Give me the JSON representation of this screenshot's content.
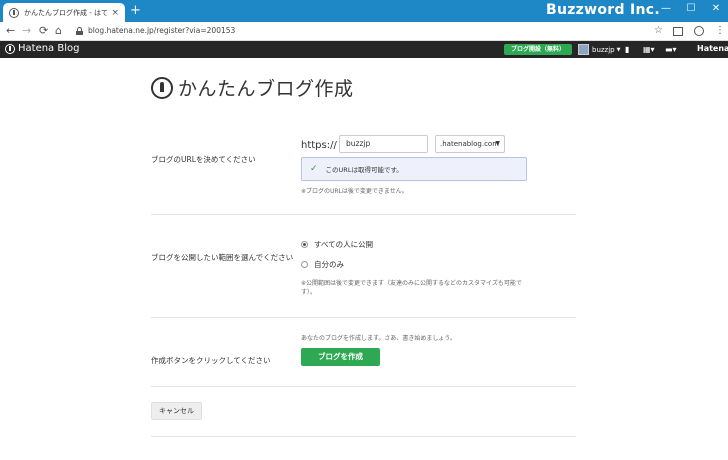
{
  "browser": {
    "tab_title": "かんたんブログ作成 - はてなブログ",
    "tab_close": "×",
    "new_tab": "+",
    "brand": "Buzzword Inc.",
    "url": "blog.hatena.ne.jp/register?via=200153",
    "win_min": "—",
    "win_max": "☐",
    "win_close": "✕",
    "back": "←",
    "forward": "→",
    "reload": "⟳",
    "home": "⌂",
    "star": "☆",
    "menu": "⋮"
  },
  "header": {
    "logo": "Hatena Blog",
    "open_blog": "ブログ開設（無料）",
    "username": "buzzjp",
    "hatena": "Hatena"
  },
  "page": {
    "title": "かんたんブログ作成",
    "url_label": "ブログのURLを決めてください",
    "prefix": "https://",
    "subdomain_value": "buzzjp",
    "domain_value": ".hatenablog.com",
    "available_msg": "このURLは取得可能です。",
    "url_note": "※ブログのURLは後で変更できません。",
    "scope_label": "ブログを公開したい範囲を選んでください",
    "scope_public": "すべての人に公開",
    "scope_private": "自分のみ",
    "scope_note": "※公開範囲は後で変更できます（友達のみに公開するなどのカスタマイズも可能です）。",
    "create_label": "作成ボタンをクリックしてください",
    "create_note": "あなたのブログを作成します。さあ、書き始めましょう。",
    "create_button": "ブログを作成",
    "cancel_button": "キャンセル"
  },
  "colors": {
    "titlebar": "#1e88c7",
    "header": "#262626",
    "primary_green": "#2ea853"
  }
}
